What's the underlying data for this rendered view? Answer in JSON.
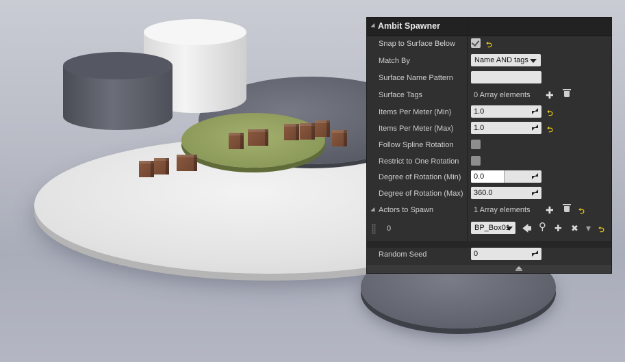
{
  "panel": {
    "title": "Ambit Spawner",
    "rows": {
      "snap": {
        "label": "Snap to Surface Below",
        "checked": true
      },
      "match_by": {
        "label": "Match By",
        "value": "Name AND tags"
      },
      "surface_name": {
        "label": "Surface Name Pattern",
        "value": ""
      },
      "surface_tags": {
        "label": "Surface Tags",
        "value": "0 Array elements"
      },
      "items_min": {
        "label": "Items Per Meter (Min)",
        "value": "1.0"
      },
      "items_max": {
        "label": "Items Per Meter (Max)",
        "value": "1.0"
      },
      "follow_spline": {
        "label": "Follow Spline Rotation",
        "checked": false
      },
      "restrict_one": {
        "label": "Restrict to One Rotation",
        "checked": false
      },
      "rot_min": {
        "label": "Degree of Rotation (Min)",
        "value": "0.0",
        "fraction": 0.0
      },
      "rot_max": {
        "label": "Degree of Rotation (Max)",
        "value": "360.0",
        "fraction": 1.0
      },
      "actors": {
        "label": "Actors to Spawn",
        "value": "1 Array elements"
      },
      "actor_0": {
        "index": "0",
        "value": "BP_Box01"
      },
      "random_seed": {
        "label": "Random Seed",
        "value": "0"
      }
    }
  },
  "icons": {
    "reset": "reset-arrow-icon",
    "add": "plus-icon",
    "delete": "trash-icon",
    "use_selected": "arrow-left-icon",
    "browse": "search-icon",
    "insert": "plus-icon",
    "clear": "x-icon",
    "more": "chevron-down-icon",
    "collapse": "collapse-up-icon"
  },
  "glyphs": {
    "reset": "⮌",
    "plus": "✚",
    "x": "✖",
    "arrow_left": "🡄",
    "search": "⚲",
    "chev": "▾"
  },
  "colors": {
    "panel_bg": "#303030",
    "header_bg": "#222222",
    "reset_yellow": "#e3c51a",
    "field_bg": "#e4e4e4"
  }
}
